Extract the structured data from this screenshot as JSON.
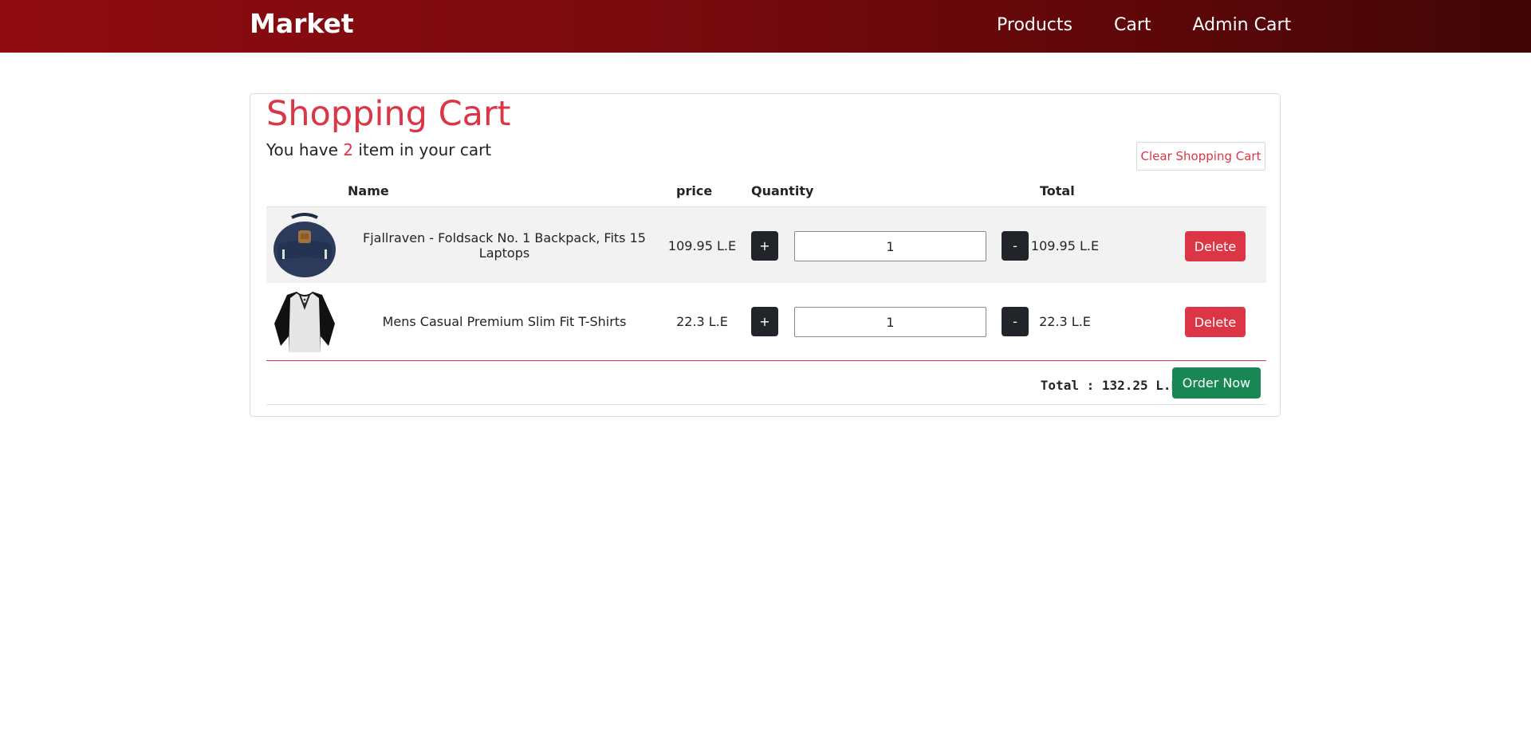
{
  "nav": {
    "brand": "Market",
    "links": [
      "Products",
      "Cart",
      "Admin Cart"
    ]
  },
  "cart": {
    "title": "Shopping Cart",
    "subtitle_prefix": "You have",
    "item_count": "2",
    "subtitle_suffix": "item in your cart",
    "clear_label": "Clear Shopping Cart",
    "headers": {
      "name": "Name",
      "price": "price",
      "quantity": "Quantity",
      "total": "Total"
    },
    "items": [
      {
        "image_icon": "backpack-image",
        "name": "Fjallraven - Foldsack No. 1 Backpack, Fits 15 Laptops",
        "price": "109.95 L.E",
        "quantity": "1",
        "total": "109.95 L.E",
        "plus": "+",
        "minus": "-",
        "delete": "Delete"
      },
      {
        "image_icon": "tshirt-image",
        "name": "Mens Casual Premium Slim Fit T-Shirts",
        "price": "22.3 L.E",
        "quantity": "1",
        "total": "22.3 L.E",
        "plus": "+",
        "minus": "-",
        "delete": "Delete"
      }
    ],
    "grand_total": "Total : 132.25 L.E",
    "order_label": "Order Now"
  },
  "colors": {
    "accent": "#dc3545",
    "nav_start": "#8f0c11",
    "nav_end": "#3f0506",
    "order": "#198754",
    "dark_button": "#212529"
  }
}
